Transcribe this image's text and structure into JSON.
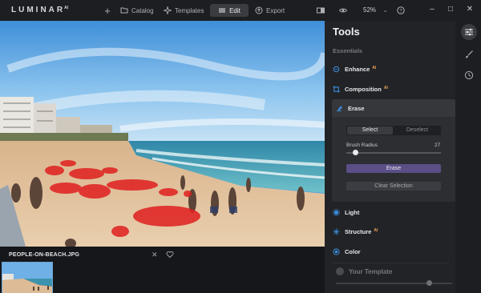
{
  "app": {
    "brand": "LUMINAR",
    "brand_superscript": "AI"
  },
  "topbar": {
    "add_label": "+",
    "catalog_label": "Catalog",
    "templates_label": "Templates",
    "edit_label": "Edit",
    "export_label": "Export",
    "zoom_value": "52%",
    "zoom_chevron": "⌄",
    "minimize_label": "–",
    "maximize_label": "□",
    "close_label": "✕",
    "icons": [
      "compare-icon",
      "eye-icon",
      "help-icon"
    ]
  },
  "filmstrip": {
    "file_name": "PEOPLE-ON-BEACH.JPG",
    "close_label": "✕"
  },
  "panel": {
    "title": "Tools",
    "section_label": "Essentials",
    "tools": [
      {
        "label": "Enhance",
        "ai": "AI",
        "icon": "enhance-icon"
      },
      {
        "label": "Composition",
        "ai": "AI",
        "icon": "composition-icon"
      },
      {
        "label": "Erase",
        "ai": "",
        "icon": "erase-icon"
      },
      {
        "label": "Light",
        "ai": "",
        "icon": "light-icon"
      },
      {
        "label": "Structure",
        "ai": "AI",
        "icon": "structure-icon"
      },
      {
        "label": "Color",
        "ai": "",
        "icon": "color-icon"
      }
    ],
    "erase": {
      "select_label": "Select",
      "deselect_label": "Deselect",
      "brush_radius_label": "Brush Radius",
      "brush_radius_value": "27",
      "brush_radius_fraction": 0.1,
      "erase_label": "Erase",
      "clear_label": "Clear Selection"
    },
    "template": {
      "label": "Your Template",
      "amount_fraction": 0.8
    }
  },
  "strip": {
    "icons": [
      "sliders-icon",
      "brush-icon",
      "history-icon"
    ]
  },
  "colors": {
    "accent_purple": "#5b4f86",
    "ai_orange": "#f0a45a",
    "tool_blue": "#3b8fe0",
    "mask_red": "#e02020"
  }
}
